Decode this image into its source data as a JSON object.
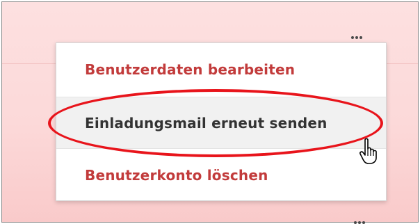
{
  "menu": {
    "items": [
      {
        "label": "Benutzerdaten bearbeiten",
        "color": "#c23b3b"
      },
      {
        "label": "Einladungsmail erneut senden",
        "color": "#333333",
        "highlighted": true
      },
      {
        "label": "Benutzerkonto löschen",
        "color": "#c23b3b"
      }
    ]
  },
  "icons": {
    "kebab": "kebab-menu-icon",
    "cursor": "hand-pointer-icon"
  },
  "colors": {
    "danger_text": "#c23b3b",
    "highlight_outline": "#e8141b",
    "background_tint": "#fcd9d9"
  }
}
